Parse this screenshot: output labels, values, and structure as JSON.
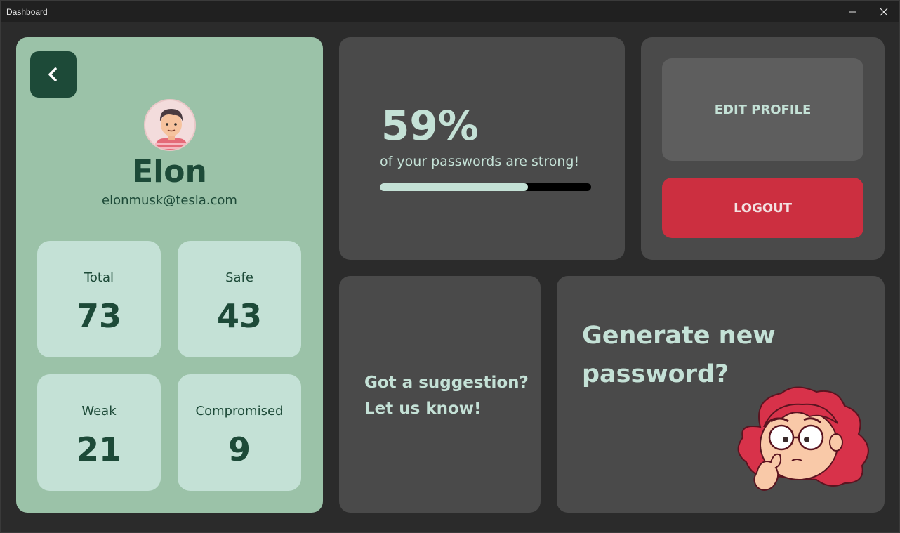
{
  "window": {
    "title": "Dashboard"
  },
  "profile": {
    "name": "Elon",
    "email": "elonmusk@tesla.com",
    "stats": [
      {
        "label": "Total",
        "value": "73"
      },
      {
        "label": "Safe",
        "value": "43"
      },
      {
        "label": "Weak",
        "value": "21"
      },
      {
        "label": "Compromised",
        "value": "9"
      }
    ]
  },
  "strength": {
    "percent": "59%",
    "text": "of your passwords are strong!",
    "bar_fill_percent": 70
  },
  "account": {
    "edit_label": "EDIT PROFILE",
    "logout_label": "LOGOUT"
  },
  "suggestion": {
    "line1": "Got a suggestion?",
    "line2": "Let us know!"
  },
  "generate": {
    "line1": "Generate new",
    "line2": "password?"
  },
  "colors": {
    "background": "#2b2b2b",
    "panel": "#4a4a4a",
    "profile_panel": "#9bc2a8",
    "stat_card": "#c4e1d6",
    "dark_green": "#1d4a38",
    "logout_red": "#cc2f40"
  },
  "icons": {
    "back": "chevron-left-icon",
    "minimize": "minimize-icon",
    "close": "close-icon"
  }
}
